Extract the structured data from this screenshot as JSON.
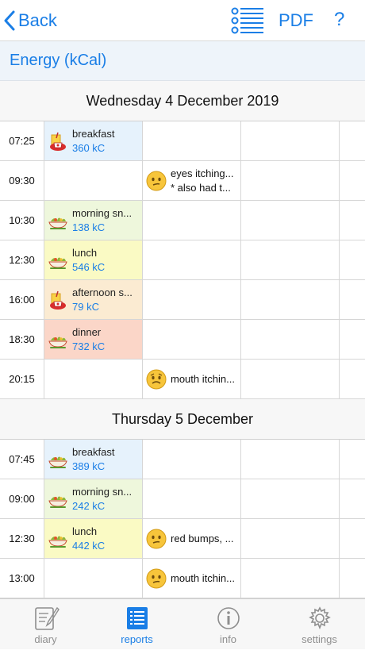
{
  "nav": {
    "back_label": "Back",
    "pdf_label": "PDF",
    "help_label": "?"
  },
  "report": {
    "title": "Energy (kCal)"
  },
  "days": [
    {
      "header": "Wednesday 4 December 2019",
      "rows": [
        {
          "time": "07:25",
          "meal": "breakfast",
          "kc": "360 kC",
          "icon": "drink-icon",
          "bg": "blue"
        },
        {
          "time": "09:30",
          "symptom": "eyes itching...",
          "symptom2": "* also had t...",
          "face": "confused-face-icon"
        },
        {
          "time": "10:30",
          "meal": "morning sn...",
          "kc": "138 kC",
          "icon": "salad-bowl-icon",
          "bg": "green"
        },
        {
          "time": "12:30",
          "meal": "lunch",
          "kc": "546 kC",
          "icon": "salad-bowl-icon",
          "bg": "yellow"
        },
        {
          "time": "16:00",
          "meal": "afternoon s...",
          "kc": "79 kC",
          "icon": "drink-icon",
          "bg": "orange"
        },
        {
          "time": "18:30",
          "meal": "dinner",
          "kc": "732 kC",
          "icon": "salad-bowl-icon",
          "bg": "red"
        },
        {
          "time": "20:15",
          "symptom": "mouth itchin...",
          "face": "worried-face-icon"
        }
      ]
    },
    {
      "header": "Thursday 5 December",
      "rows": [
        {
          "time": "07:45",
          "meal": "breakfast",
          "kc": "389 kC",
          "icon": "salad-bowl-icon",
          "bg": "blue"
        },
        {
          "time": "09:00",
          "meal": "morning sn...",
          "kc": "242 kC",
          "icon": "salad-bowl-icon",
          "bg": "green"
        },
        {
          "time": "12:30",
          "meal": "lunch",
          "kc": "442 kC",
          "icon": "salad-bowl-icon",
          "bg": "yellow",
          "symptom": "red bumps, ...",
          "face": "confused-face-icon"
        },
        {
          "time": "13:00",
          "symptom": "mouth itchin...",
          "face": "confused-face-icon"
        }
      ]
    }
  ],
  "tabs": [
    {
      "label": "diary",
      "icon": "notebook-pencil-icon",
      "active": false
    },
    {
      "label": "reports",
      "icon": "list-report-icon",
      "active": true
    },
    {
      "label": "info",
      "icon": "info-icon",
      "active": false
    },
    {
      "label": "settings",
      "icon": "gear-icon",
      "active": false
    }
  ],
  "colors": {
    "accent": "#1a7ee6",
    "blue": "#e6f2fc",
    "green": "#eef7dc",
    "yellow": "#fafac4",
    "orange": "#fbebd2",
    "red": "#fbd6c8"
  }
}
